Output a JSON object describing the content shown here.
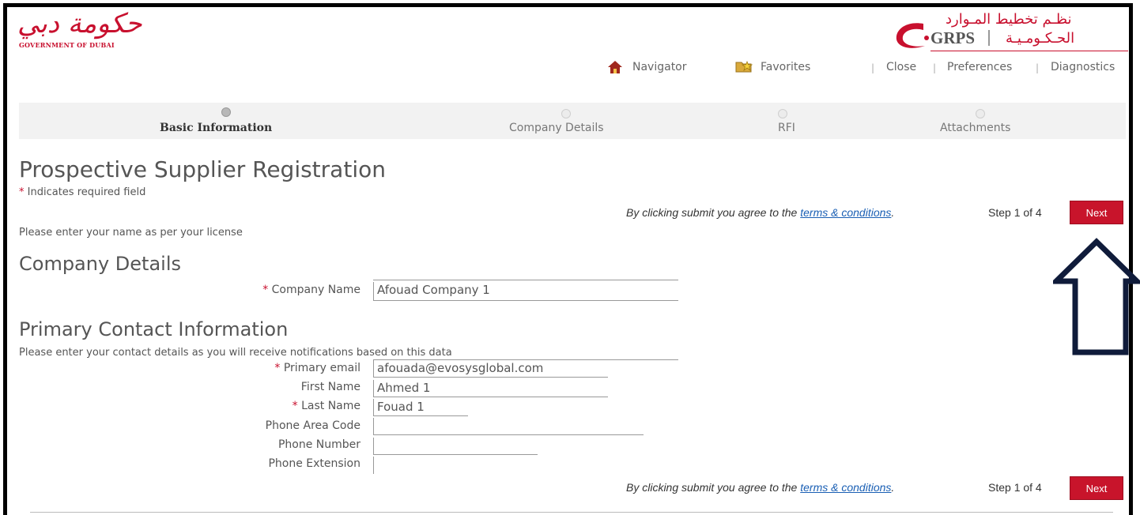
{
  "header": {
    "gov_logo_arabic": "حكومة دبي",
    "gov_logo_english": "GOVERNMENT OF DUBAI",
    "grps_arabic_top": "نظـم تخطيط المـوارد",
    "grps_brand": "GRPS",
    "grps_arabic_bottom": "الحـكـومـيـة"
  },
  "topnav": {
    "navigator": "Navigator",
    "favorites": "Favorites",
    "close": "Close",
    "preferences": "Preferences",
    "diagnostics": "Diagnostics",
    "separator": "|"
  },
  "train": {
    "steps": [
      {
        "label": "Basic Information",
        "active": true
      },
      {
        "label": "Company Details",
        "active": false
      },
      {
        "label": "RFI",
        "active": false
      },
      {
        "label": "Attachments",
        "active": false
      }
    ]
  },
  "page": {
    "title": "Prospective Supplier Registration",
    "required_star": "*",
    "required_note": "Indicates required field",
    "agree_prefix": "By clicking submit you agree to the ",
    "terms_link": "terms & conditions",
    "agree_suffix": ".",
    "step_count": "Step 1 of 4",
    "next_label": "Next",
    "license_hint": "Please enter your name as per your license"
  },
  "company": {
    "section_title": "Company Details",
    "company_name_label": "Company Name",
    "company_name_value": "Afouad Company 1"
  },
  "contact": {
    "section_title": "Primary Contact Information",
    "hint": "Please enter your contact details as you will receive notifications based on this data",
    "primary_email_label": "Primary email",
    "primary_email_value": "afouada@evosysglobal.com",
    "first_name_label": "First Name",
    "first_name_value": "Ahmed 1",
    "last_name_label": "Last Name",
    "last_name_value": "Fouad 1",
    "phone_area_label": "Phone Area Code",
    "phone_area_value": "",
    "phone_number_label": "Phone Number",
    "phone_number_value": "",
    "phone_ext_label": "Phone Extension",
    "phone_ext_value": ""
  },
  "colors": {
    "brand_red": "#c8142b",
    "link_blue": "#1a5fb4",
    "annotation_arrow": "#0f1b3a"
  }
}
